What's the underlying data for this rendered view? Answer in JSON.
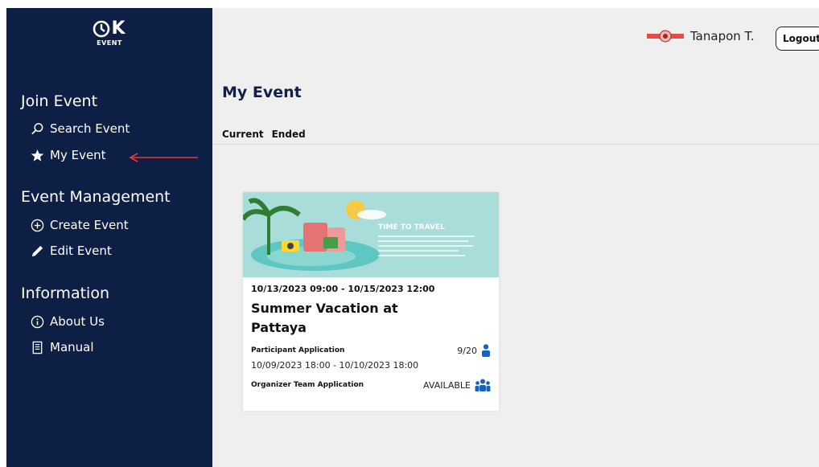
{
  "brand": {
    "mark": "K",
    "sub": "EVENT"
  },
  "sidebar": {
    "sections": [
      {
        "title": "Join Event",
        "items": [
          {
            "label": "Search Event",
            "icon": "search-icon"
          },
          {
            "label": "My Event",
            "icon": "star-icon"
          }
        ]
      },
      {
        "title": "Event Management",
        "items": [
          {
            "label": "Create Event",
            "icon": "plus-circle-icon"
          },
          {
            "label": "Edit Event",
            "icon": "pencil-icon"
          }
        ]
      },
      {
        "title": "Information",
        "items": [
          {
            "label": "About Us",
            "icon": "info-circle-icon"
          },
          {
            "label": "Manual",
            "icon": "document-icon"
          }
        ]
      }
    ]
  },
  "header": {
    "user_name": "Tanapon T.",
    "logout_label": "Logout"
  },
  "main": {
    "title": "My Event",
    "tabs": [
      "Current",
      "Ended"
    ],
    "events": [
      {
        "banner_text": "TIME TO TRAVEL",
        "dates": "10/13/2023 09:00 - 10/15/2023 12:00",
        "title": "Summer Vacation at Pattaya",
        "participant_label": "Participant Application",
        "participant_count": "9/20",
        "participant_dates": "10/09/2023 18:00 - 10/10/2023 18:00",
        "organizer_label": "Organizer Team Application",
        "organizer_status": "AVAILABLE"
      }
    ]
  },
  "colors": {
    "sidebar_bg": "#0e1f45",
    "main_bg": "#efefef",
    "accent_blue": "#1565c0",
    "annotation_red": "#e53935"
  }
}
